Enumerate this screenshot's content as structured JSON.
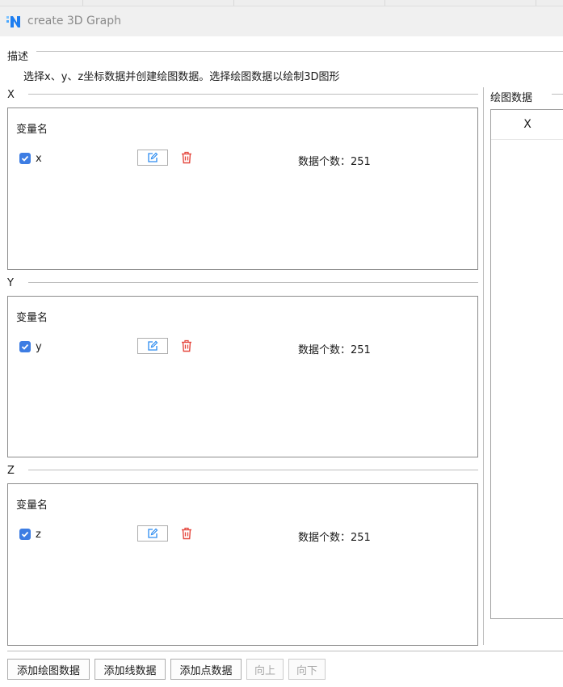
{
  "window": {
    "title": "create 3D Graph"
  },
  "description": {
    "label": "描述",
    "text": "选择x、y、z坐标数据并创建绘图数据。选择绘图数据以绘制3D图形"
  },
  "sections": [
    {
      "label": "X",
      "header": "变量名",
      "variable": "x",
      "checked": true,
      "count_text": "数据个数：251"
    },
    {
      "label": "Y",
      "header": "变量名",
      "variable": "y",
      "checked": true,
      "count_text": "数据个数：251"
    },
    {
      "label": "Z",
      "header": "变量名",
      "variable": "z",
      "checked": true,
      "count_text": "数据个数：251"
    }
  ],
  "plot_data": {
    "label": "绘图数据",
    "column_header": "X"
  },
  "buttons": {
    "add_plot": "添加绘图数据",
    "add_line": "添加线数据",
    "add_point": "添加点数据",
    "move_up": "向上",
    "move_down": "向下"
  },
  "colors": {
    "accent": "#3d7de3",
    "delete": "#e5483f",
    "icon_blue": "#2d8cf0"
  },
  "icons": {
    "app": "n-logo-icon",
    "edit": "edit-icon",
    "delete": "trash-icon",
    "check": "check-icon"
  }
}
